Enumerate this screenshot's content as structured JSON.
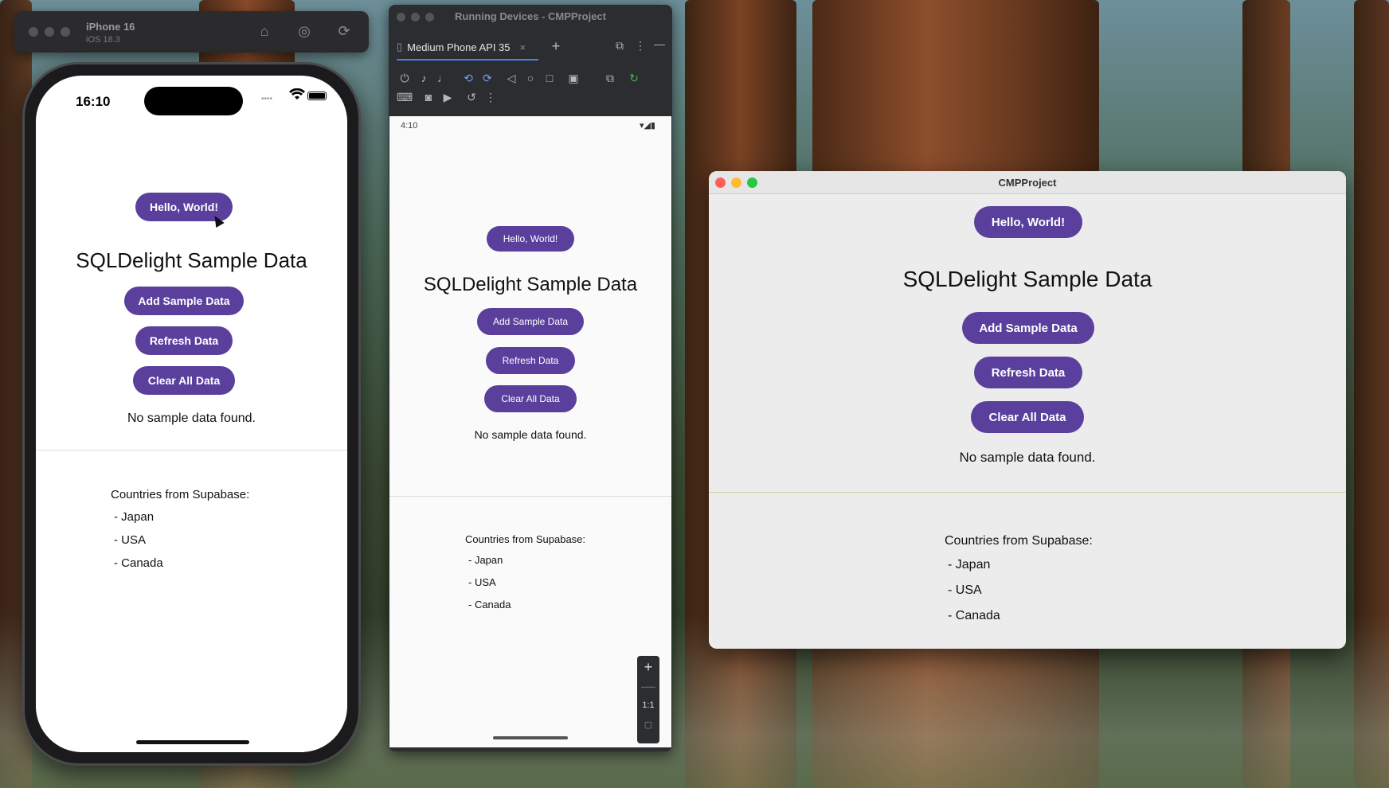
{
  "colors": {
    "button": "#5b3f9c",
    "close": "#ff5f57",
    "minimize": "#febc2e",
    "zoom": "#28c840"
  },
  "simulator": {
    "device_name": "iPhone 16",
    "os_version": "iOS 18.3",
    "status_time": "16:10"
  },
  "android_window": {
    "title": "Running Devices - CMPProject",
    "tab_label": "Medium Phone API 35",
    "status_time": "4:10",
    "zoom_ratio": "1:1"
  },
  "desktop_window": {
    "title": "CMPProject"
  },
  "app": {
    "hello_button": "Hello, World!",
    "heading": "SQLDelight Sample Data",
    "add_button": "Add Sample Data",
    "refresh_button": "Refresh Data",
    "clear_button": "Clear All Data",
    "empty_message": "No sample data found.",
    "countries_title": "Countries from Supabase:",
    "countries": [
      "- Japan",
      "- USA",
      "- Canada"
    ]
  }
}
